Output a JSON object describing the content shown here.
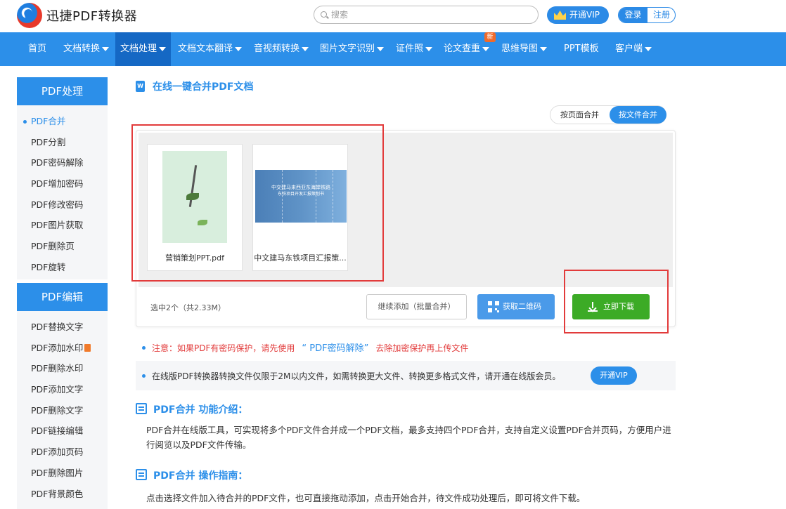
{
  "header": {
    "brand": "迅捷PDF转换器",
    "search_placeholder": "搜索",
    "vip_label": "开通VIP",
    "login": "登录",
    "register": "注册"
  },
  "nav": {
    "items": [
      {
        "label": "首页"
      },
      {
        "label": "文档转换"
      },
      {
        "label": "文档处理"
      },
      {
        "label": "文档文本翻译"
      },
      {
        "label": "音视频转换"
      },
      {
        "label": "图片文字识别"
      },
      {
        "label": "证件照"
      },
      {
        "label": "论文查重"
      },
      {
        "label": "思维导图"
      },
      {
        "label": "PPT模板"
      },
      {
        "label": "客户端"
      }
    ],
    "new_badge": "新"
  },
  "sidebar": {
    "group1_title": "PDF处理",
    "group1_items": [
      "PDF合并",
      "PDF分割",
      "PDF密码解除",
      "PDF增加密码",
      "PDF修改密码",
      "PDF图片获取",
      "PDF删除页",
      "PDF旋转"
    ],
    "group2_title": "PDF编辑",
    "group2_items": [
      "PDF替换文字",
      "PDF添加水印",
      "PDF删除水印",
      "PDF添加文字",
      "PDF删除文字",
      "PDF链接编辑",
      "PDF添加页码",
      "PDF删除图片",
      "PDF背景颜色"
    ]
  },
  "main": {
    "word_icon": "W",
    "title": "在线一键合并PDF文档",
    "mode_by_page": "按页面合并",
    "mode_by_file": "按文件合并",
    "files": [
      {
        "name": "营销策划PPT.pdf"
      },
      {
        "name": "中文建马东铁项目汇报策..."
      }
    ],
    "thumb2_line1": "中交建马来西亚东海岸铁路",
    "thumb2_line2": "东铁项目开发汇报策划书",
    "status": "选中2个（共2.33M）",
    "continue_add": "继续添加（批量合并）",
    "get_qr": "获取二维码",
    "download": "立即下载",
    "notice_prefix": "注意：如果PDF有密码保护，请先使用",
    "notice_link": "“ PDF密码解除”",
    "notice_suffix": "去除加密保护再上传文件",
    "info_text": "在线版PDF转换器转换文件仅限于2M以内文件，如需转换更大文件、转换更多格式文件，请开通在线版会员。",
    "info_vip": "开通VIP",
    "intro_title": "PDF合并 功能介绍：",
    "intro_body": "PDF合并在线版工具，可实现将多个PDF文件合并成一个PDF文档，最多支持四个PDF合并，支持自定义设置PDF合并页码，方便用户进行阅览以及PDF文件传输。",
    "guide_title": "PDF合并 操作指南：",
    "guide_body": "点击选择文件加入待合并的PDF文件，也可直接拖动添加，点击开始合并，待文件成功处理后，即可将文件下载。"
  },
  "colors": {
    "primary": "#2c8fe9",
    "nav_active": "#1568c4",
    "download": "#3cab26",
    "annotation": "#e23b3b"
  }
}
